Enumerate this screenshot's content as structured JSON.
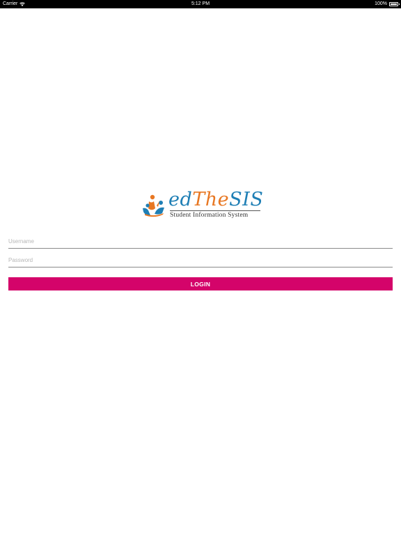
{
  "status_bar": {
    "carrier": "Carrier",
    "time": "5:12 PM",
    "battery": "100%",
    "battery_level": 1.0,
    "wifi_icon": "wifi-icon",
    "battery_icon": "battery-icon"
  },
  "logo": {
    "name_part_1": "ed",
    "name_part_2": "The",
    "name_part_3": "SIS",
    "tagline": "Student Information System",
    "emblem_icon": "people-emblem-icon",
    "colors": {
      "blue": "#1f7fb5",
      "orange": "#e87722"
    }
  },
  "form": {
    "username_placeholder": "Username",
    "username_value": "",
    "password_placeholder": "Password",
    "password_value": "",
    "login_label": "LOGIN"
  },
  "colors": {
    "accent": "#d4046a",
    "status_bar": "#000000",
    "background": "#ffffff"
  }
}
